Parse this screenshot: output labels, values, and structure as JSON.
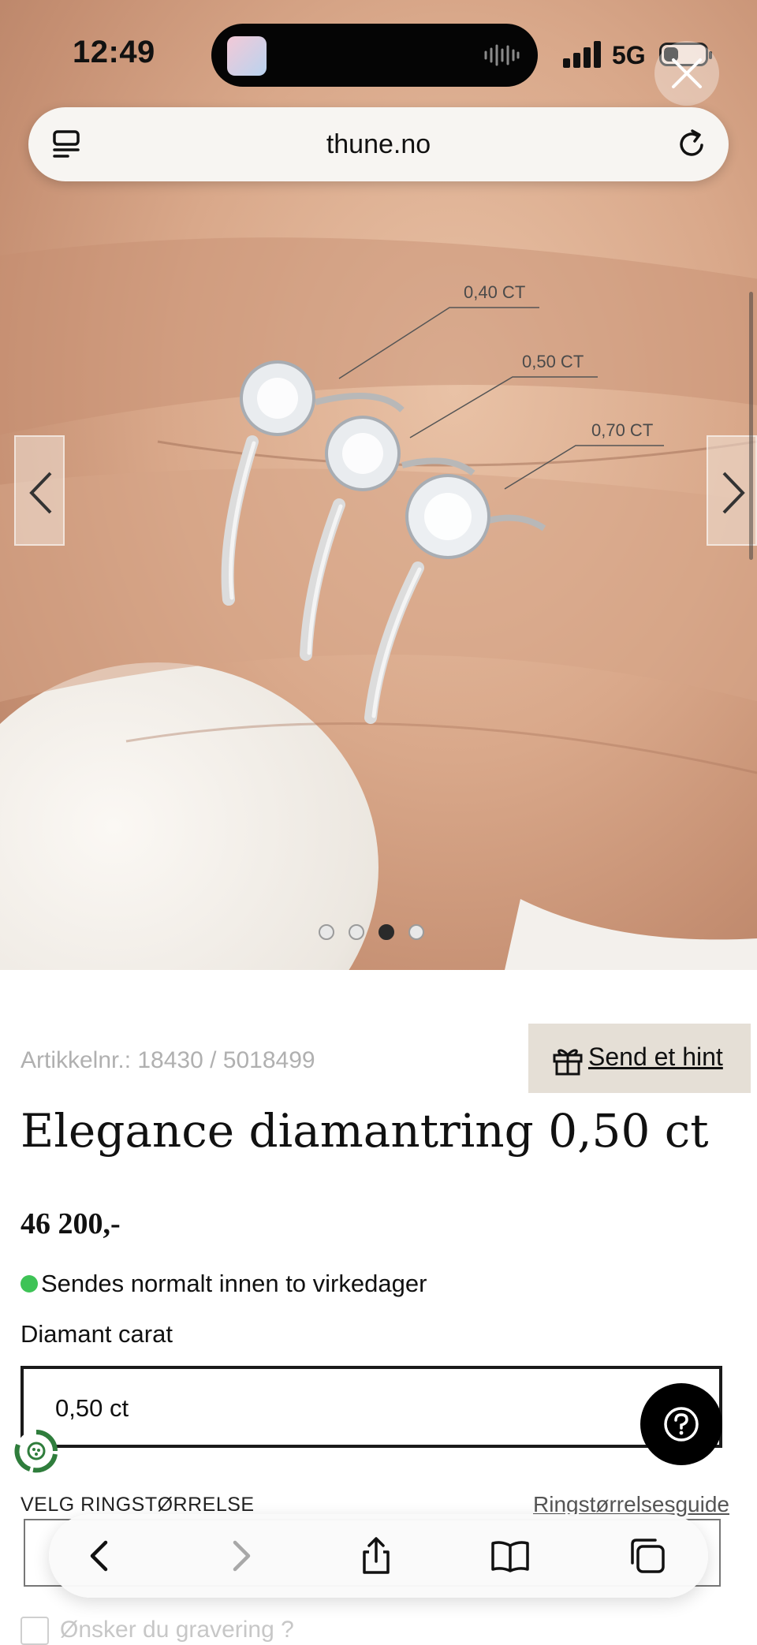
{
  "status_bar": {
    "time": "12:49",
    "network": "5G"
  },
  "browser": {
    "url": "thune.no"
  },
  "gallery": {
    "annotations": [
      "0,40 CT",
      "0,50 CT",
      "0,70 CT"
    ],
    "dot_count": 4,
    "active_index": 2
  },
  "product": {
    "sku": "Artikkelnr.: 18430 / 5018499",
    "hint_label": "Send et hint",
    "title": "Elegance diamantring 0,50 ct",
    "price": "46 200,-",
    "shipping": "Sendes normalt innen to virkedager",
    "carat_label": "Diamant carat",
    "carat_value": "0,50 ct",
    "size_label": "VELG RINGSTØRRELSE",
    "size_guide": "Ringstørrelsesguide",
    "engraving_label": "Ønsker du gravering ?"
  },
  "colors": {
    "in_stock": "#3ec356",
    "hint_bg": "#e5dfd6",
    "help_bg": "#000000"
  },
  "icons": {
    "reader": "reader-icon",
    "reload": "reload-icon",
    "gift": "gift-icon",
    "help": "question-icon",
    "eco": "recycle-icon",
    "toolbar": [
      "back-icon",
      "forward-icon",
      "share-icon",
      "bookmarks-icon",
      "tabs-icon"
    ]
  }
}
